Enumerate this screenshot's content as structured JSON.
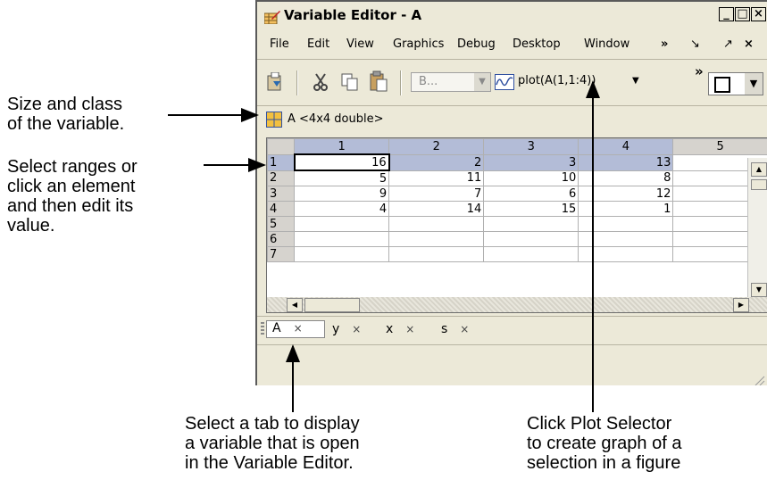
{
  "window": {
    "title": "Variable Editor - A",
    "minimize": "_",
    "maximize": "□",
    "close": "×"
  },
  "menu": [
    "File",
    "Edit",
    "View",
    "Graphics",
    "Debug",
    "Desktop",
    "Window"
  ],
  "menu_extras": {
    "overflow": "»",
    "undock_down": "↘",
    "undock_up": "↗",
    "close": "×"
  },
  "toolbar": {
    "combo_value": "B...",
    "plot_selector": "plot(A(1,1:4))",
    "dropdown_arrow": "▼",
    "overflow": "»"
  },
  "variable_info": "A <4x4 double>",
  "grid": {
    "columns": [
      "1",
      "2",
      "3",
      "4",
      "5"
    ],
    "rows": [
      {
        "label": "1",
        "cells": [
          "16",
          "2",
          "3",
          "13",
          ""
        ]
      },
      {
        "label": "2",
        "cells": [
          "5",
          "11",
          "10",
          "8",
          ""
        ]
      },
      {
        "label": "3",
        "cells": [
          "9",
          "7",
          "6",
          "12",
          ""
        ]
      },
      {
        "label": "4",
        "cells": [
          "4",
          "14",
          "15",
          "1",
          ""
        ]
      },
      {
        "label": "5",
        "cells": [
          "",
          "",
          "",
          "",
          ""
        ]
      },
      {
        "label": "6",
        "cells": [
          "",
          "",
          "",
          "",
          ""
        ]
      },
      {
        "label": "7",
        "cells": [
          "",
          "",
          "",
          "",
          ""
        ]
      }
    ]
  },
  "tabs": [
    {
      "label": "A",
      "close": "×"
    },
    {
      "label": "y",
      "close": "×"
    },
    {
      "label": "x",
      "close": "×"
    },
    {
      "label": "s",
      "close": "×"
    }
  ],
  "annotations": {
    "size_class": [
      "Size and class",
      "of the variable."
    ],
    "select_ranges": [
      "Select ranges or",
      "click an element",
      "and then edit its",
      "value."
    ],
    "select_tab": [
      "Select a tab to display",
      "a variable that is open",
      "in the Variable Editor."
    ],
    "plot_selector": [
      "Click Plot Selector",
      "to create graph of a",
      "selection in a figure"
    ]
  },
  "colors": {
    "window_bg": "#ece9d8",
    "selection": "#b3bcd7",
    "header_bg": "#d6d3ce"
  }
}
